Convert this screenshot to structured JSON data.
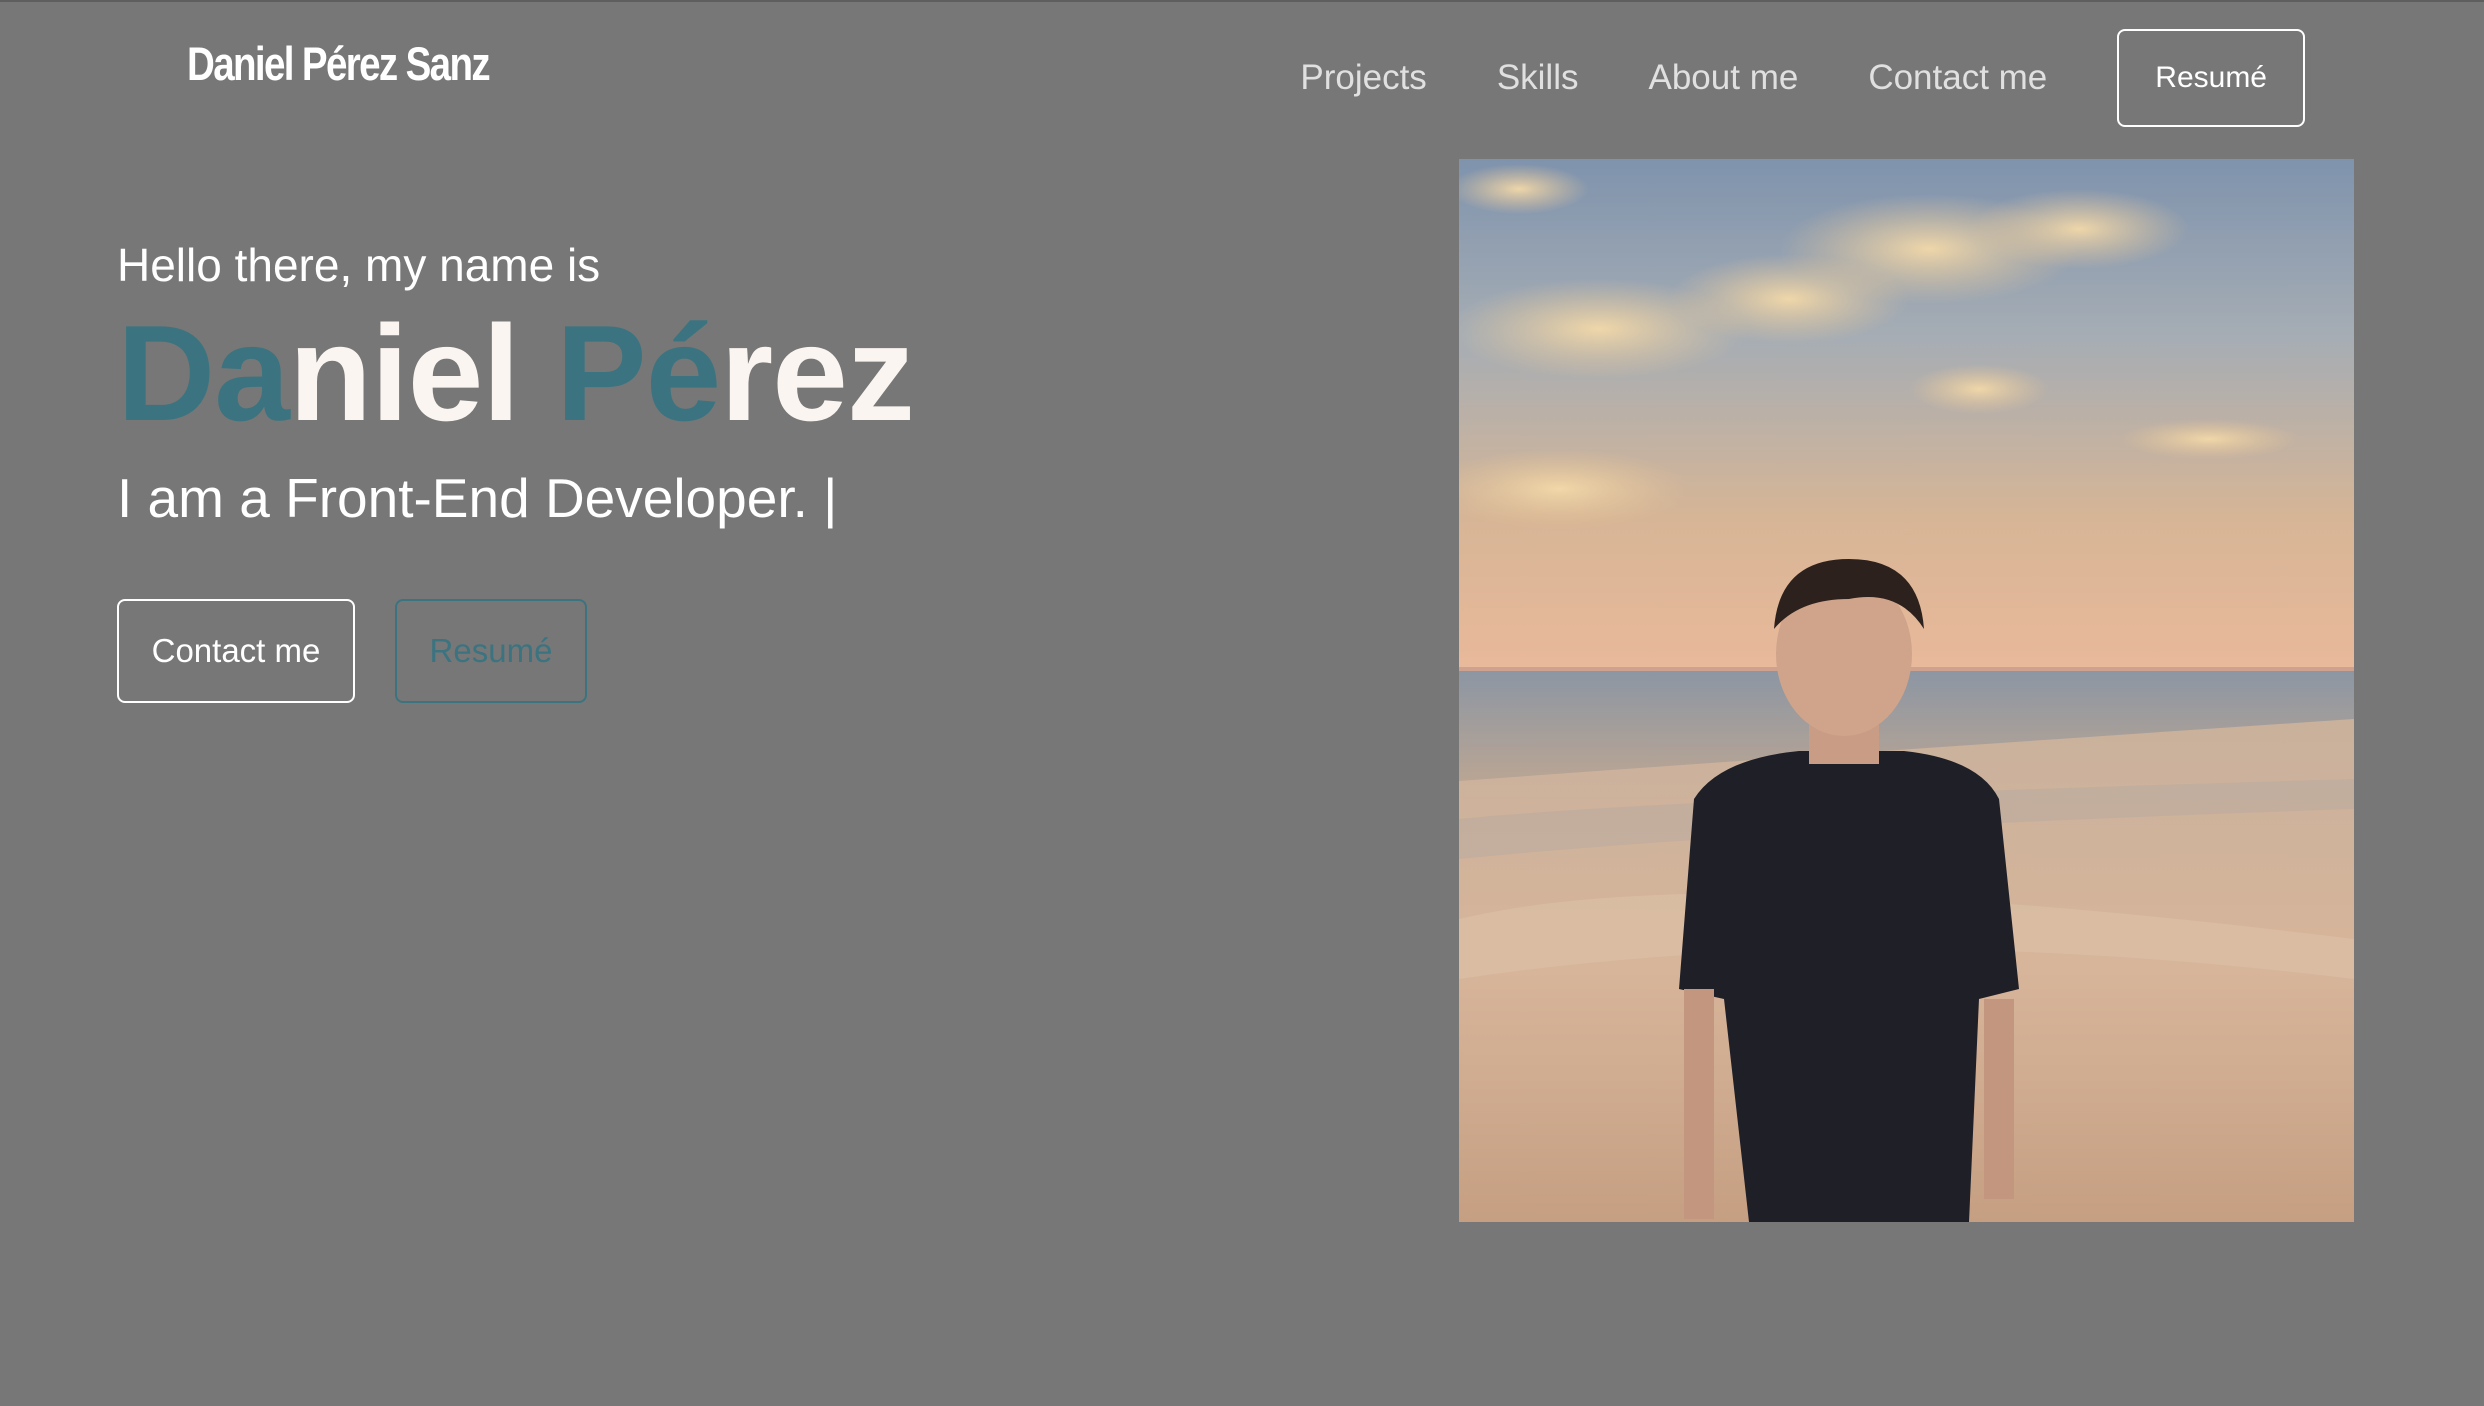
{
  "header": {
    "logo": "Daniel Pérez Sanz",
    "nav": [
      {
        "label": "Projects"
      },
      {
        "label": "Skills"
      },
      {
        "label": "About me"
      },
      {
        "label": "Contact me"
      }
    ],
    "resume_button": "Resumé"
  },
  "hero": {
    "greeting": "Hello there, my name is",
    "name_parts": [
      "Da",
      "niel ",
      "Pé",
      "rez"
    ],
    "tagline": "I am a Front-End Developer. |",
    "contact_button": "Contact me",
    "resume_button": "Resumé"
  },
  "colors": {
    "background": "#777777",
    "accent": "#3b7480",
    "text": "#ffffff"
  },
  "photo": {
    "icon": "profile-photo"
  }
}
